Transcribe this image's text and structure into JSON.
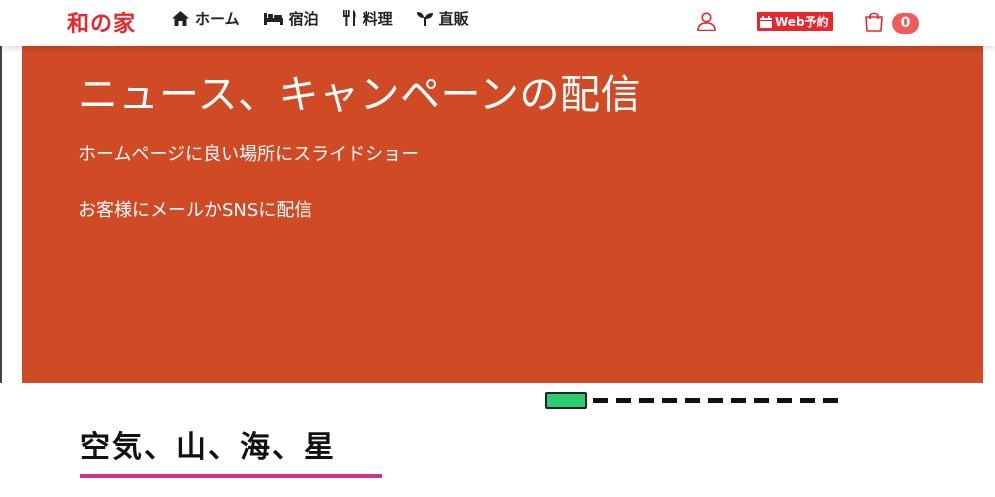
{
  "header": {
    "logo": "和の家",
    "nav": [
      {
        "label": "ホーム",
        "icon": "home-icon"
      },
      {
        "label": "宿泊",
        "icon": "bed-icon"
      },
      {
        "label": "料理",
        "icon": "utensils-icon"
      },
      {
        "label": "直販",
        "icon": "seedling-icon"
      }
    ],
    "user_icon": "user-icon",
    "web_reserve_label": "Web予約",
    "cart_icon": "shopping-bag-icon",
    "cart_count": "0"
  },
  "hero": {
    "title": "ニュース、キャンペーンの配信",
    "line1": "ホームページに良い場所にスライドショー",
    "line2": "お客様にメールかSNSに配信"
  },
  "carousel": {
    "slide_count": 12,
    "active_index": 0
  },
  "section": {
    "title": "空気、山、海、星"
  },
  "colors": {
    "brand": "#e8262b",
    "hero_background": "#d04a26",
    "active_dot": "#2ecc71",
    "accent_underline": "#cc3399"
  }
}
